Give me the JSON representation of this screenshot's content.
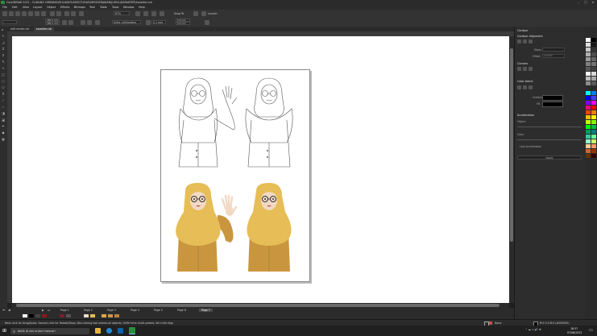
{
  "app": {
    "title": "CorelDRAW 2021 - D:\\BANG UMBANG\\MULAI\\KOLEKSI\\TUGAS\\MENGERJAKAN\\JUDUL\\KARAKTER\\karakter.cdr"
  },
  "menu": [
    "File",
    "Edit",
    "View",
    "Layout",
    "Object",
    "Effects",
    "Bitmaps",
    "Text",
    "Table",
    "Tools",
    "Window",
    "Help"
  ],
  "toolbar": {
    "zoom_value": "87%",
    "snap_label": "Snap To",
    "launch_label": "Launch",
    "width_value": "180.0 mm",
    "height_value": "285.0 mm",
    "units_label": "Units: millimeters",
    "nudge_value": "0.1 mm",
    "dup_x": "5.0 mm",
    "dup_y": "5.0 mm"
  },
  "tabs": [
    {
      "label": "edit render.cdr"
    },
    {
      "label": "karakter.cdr"
    }
  ],
  "pages": [
    "Page 1",
    "Page 2",
    "Page 3",
    "Page 4",
    "Page 5",
    "Page 6",
    "Page 7"
  ],
  "active_page_index": 6,
  "status": {
    "hint": "Next click for Drag/Scale; Second click for Rotate/Skew; Dbl-clicking tool selects all objects; Shift+click multi-selects; Alt+click digs",
    "fill": "None",
    "color_info": "R:0 G:0 B:0 (#000000)"
  },
  "docker": {
    "title": "Contour",
    "section_alignment": "Contour alignment",
    "steps_label": "Steps",
    "offset_label": "Offset",
    "offset_value": "1.0 mm",
    "section_corners": "Corners",
    "section_color_blend": "Color blend",
    "outline_label": "Outline",
    "fill_label": "Fill",
    "section_acceleration": "Acceleration",
    "object_label": "Object",
    "color_label": "Color",
    "link_label": "Link acceleration",
    "apply_label": "Apply"
  },
  "taskbar": {
    "search_placeholder": "Ketik di sini untuk mencari",
    "time": "18:37",
    "date": "07/08/2022"
  },
  "colors": {
    "mustard": "#d8a84a",
    "mustard_dark": "#b8863a",
    "hijab": "#e6bd56",
    "skin": "#f1d9c4",
    "canvas": "#ffffff",
    "ui_dark": "#2b2b2b"
  }
}
